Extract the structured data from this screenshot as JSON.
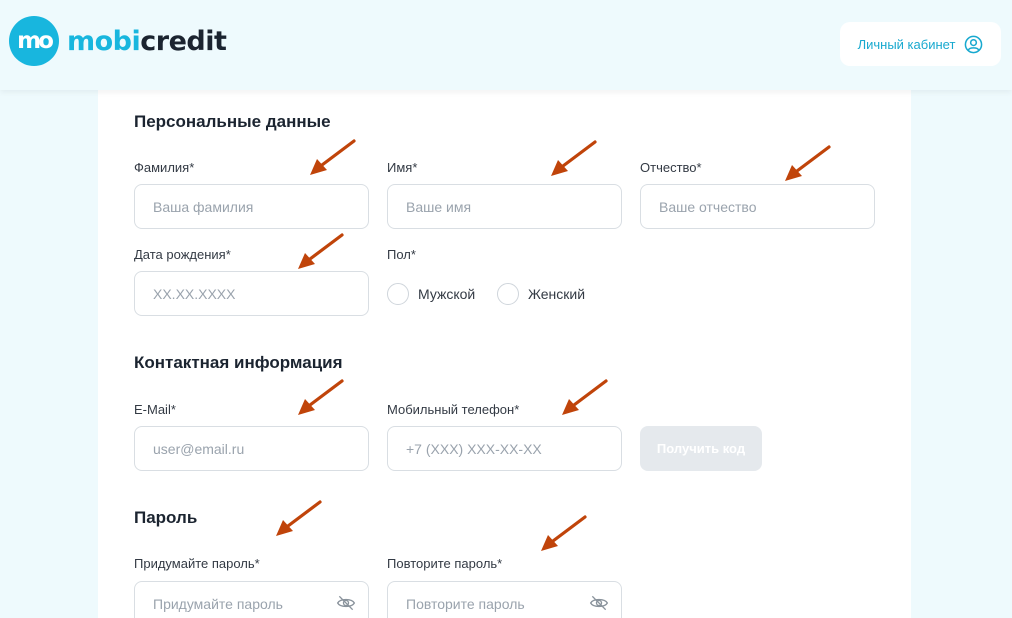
{
  "header": {
    "logo_mark": "mo",
    "logo_part1": "mobi",
    "logo_part2": "credit",
    "account_label": "Личный кабинет"
  },
  "personal": {
    "title": "Персональные данные",
    "surname_label": "Фамилия*",
    "surname_placeholder": "Ваша фамилия",
    "name_label": "Имя*",
    "name_placeholder": "Ваше имя",
    "patronymic_label": "Отчество*",
    "patronymic_placeholder": "Ваше отчество",
    "birth_label": "Дата рождения*",
    "birth_placeholder": "XX.XX.XXXX",
    "gender_label": "Пол*",
    "gender_male": "Мужской",
    "gender_female": "Женский"
  },
  "contact": {
    "title": "Контактная информация",
    "email_label": "E-Mail*",
    "email_placeholder": "user@email.ru",
    "phone_label": "Мобильный телефон*",
    "phone_placeholder": "+7 (XXX) XXX-XX-XX",
    "code_button": "Получить код"
  },
  "password": {
    "title": "Пароль",
    "create_label": "Придумайте пароль*",
    "create_placeholder": "Придумайте пароль",
    "repeat_label": "Повторите пароль*",
    "repeat_placeholder": "Повторите пароль"
  },
  "colors": {
    "brand": "#18b6de",
    "annotation_arrow": "#c0440a"
  }
}
